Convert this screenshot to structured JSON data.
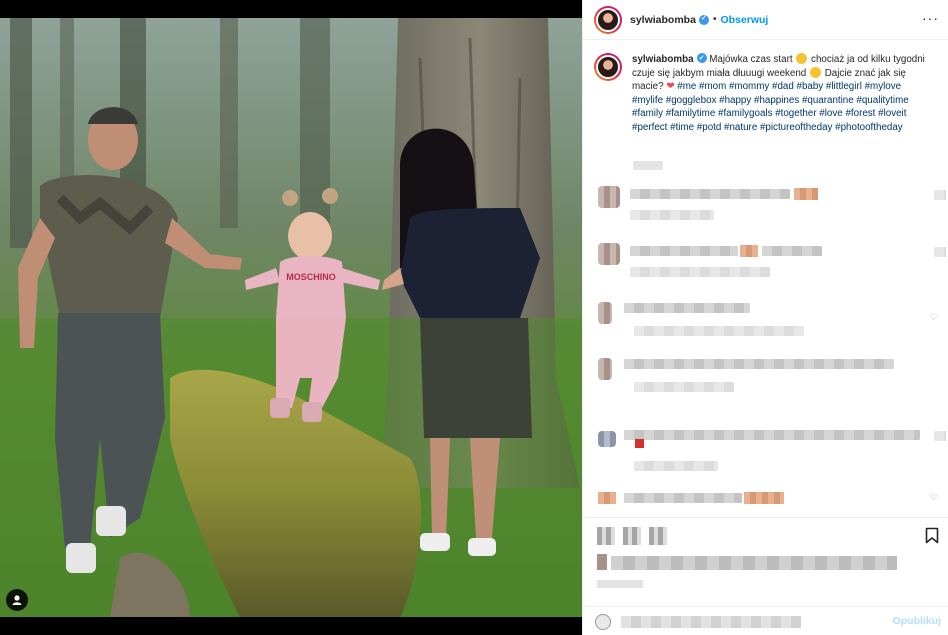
{
  "post": {
    "username": "sylwiabomba",
    "follow_label": "Obserwuj",
    "more_label": "···",
    "separator": "•"
  },
  "caption": {
    "username": "sylwiabomba",
    "text_part1": "Majówka czas start",
    "text_part2": "chociaż ja od kilku tygodni czuje się jakbym miała dłuuugi weekend",
    "text_part3": "Dajcie znać jak się macie?",
    "hashtags": "#me #mom #mommy #dad #baby #littlegirl #mylove #mylife #gogglebox #happy #happines #quarantine #qualitytime #family #familytime #familygoals #together #love #forest #loveit #perfect #time #potd #nature #pictureoftheday #photooftheday",
    "heart": "❤"
  },
  "add_comment": {
    "publish_label": "Opublikuj"
  },
  "colors": {
    "accent": "#0095f6",
    "hashtag": "#00376b",
    "verified": "#3897f0",
    "heart": "#ed4956"
  },
  "icons": {
    "tag": "user-tag-icon",
    "verified": "verified-badge-icon",
    "bookmark": "bookmark-icon",
    "emoji": "emoji-icon",
    "comment_like": "heart-outline-icon"
  }
}
